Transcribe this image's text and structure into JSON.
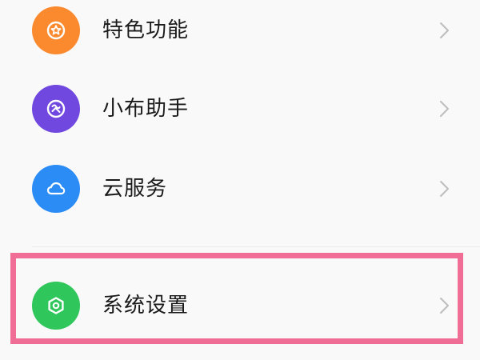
{
  "settings": {
    "items": [
      {
        "label": "特色功能",
        "icon": "star-badge-icon",
        "color": "#fb8a2f"
      },
      {
        "label": "小布助手",
        "icon": "breeno-assistant-icon",
        "color": "#7048e0"
      },
      {
        "label": "云服务",
        "icon": "cloud-icon",
        "color": "#2b8cf5"
      },
      {
        "label": "系统设置",
        "icon": "hexagon-settings-icon",
        "color": "#2fc75b"
      }
    ]
  },
  "annotation": {
    "highlight_color": "#f06e95",
    "highlighted_item": "系统设置"
  }
}
